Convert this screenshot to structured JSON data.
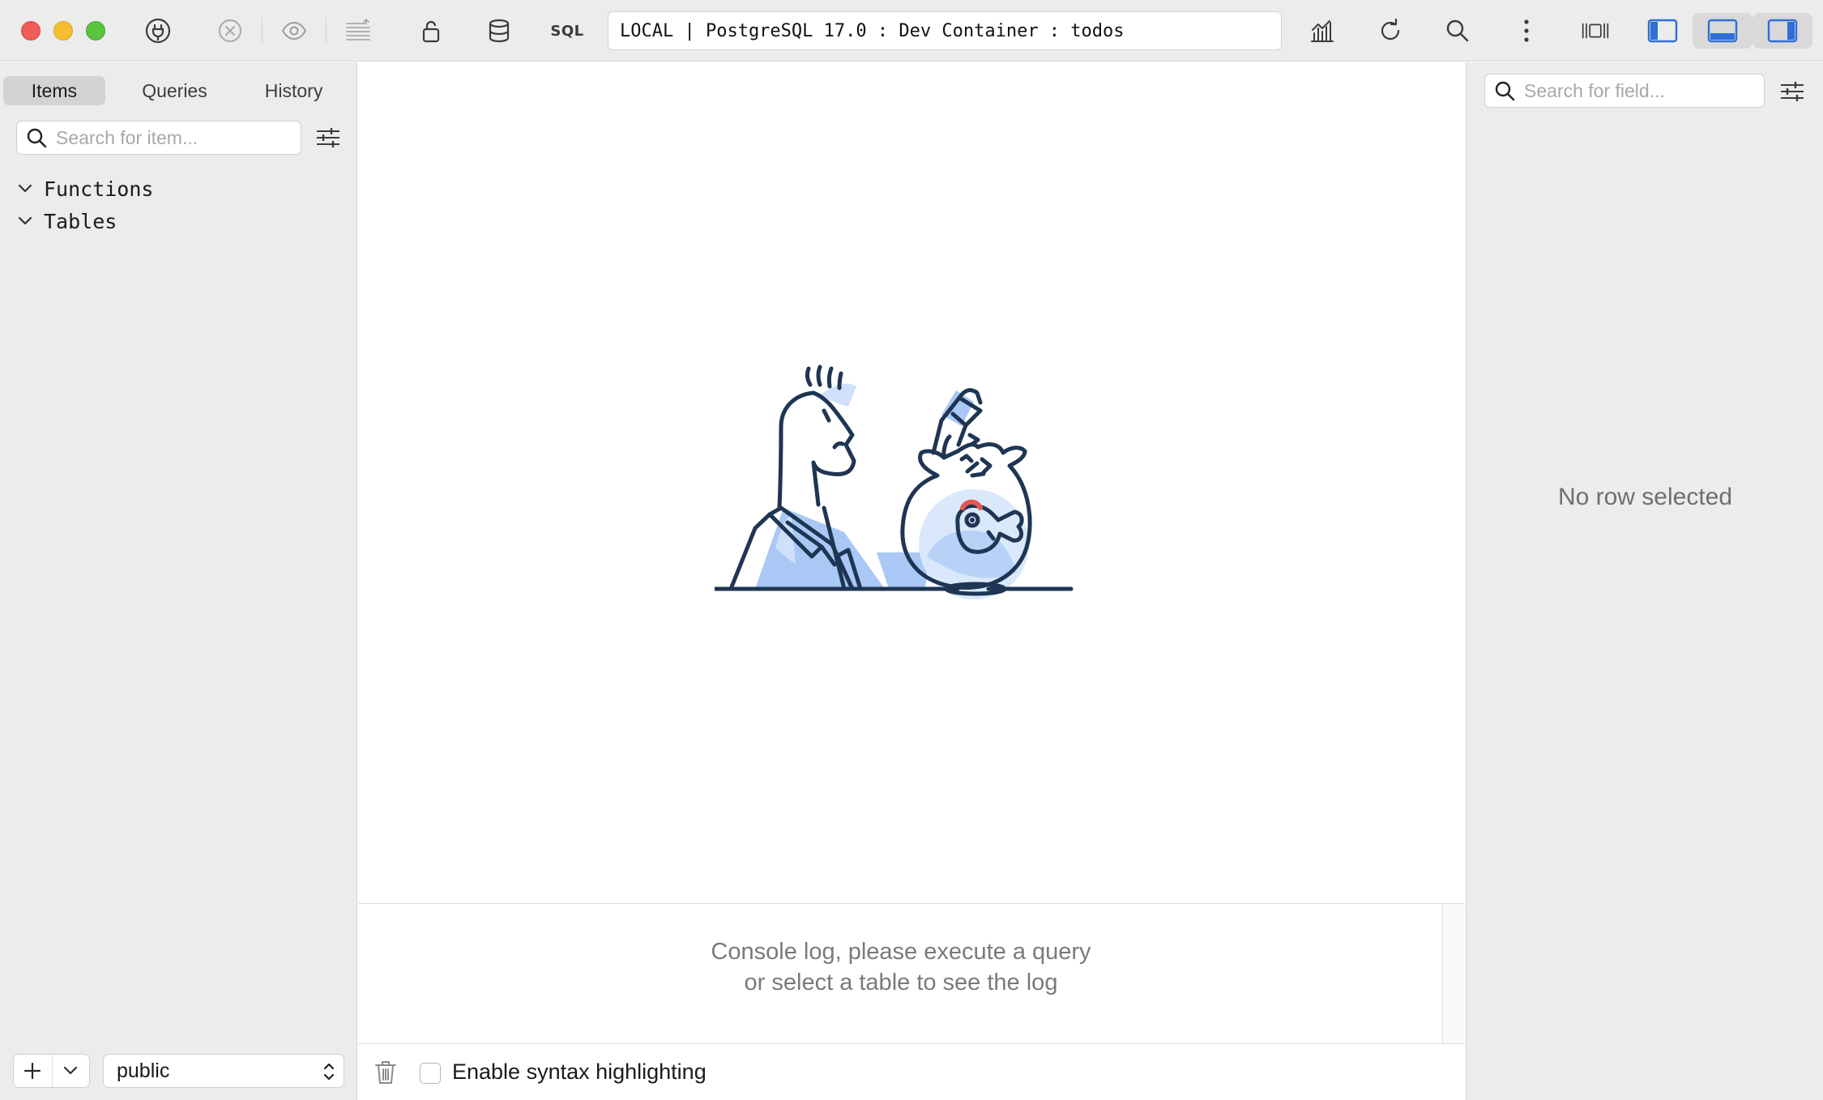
{
  "toolbar": {
    "sql_label": "SQL",
    "connection": "LOCAL | PostgreSQL 17.0 : Dev Container : todos"
  },
  "sidebar": {
    "tabs": [
      {
        "label": "Items",
        "active": true
      },
      {
        "label": "Queries",
        "active": false
      },
      {
        "label": "History",
        "active": false
      }
    ],
    "search_placeholder": "Search for item...",
    "tree": [
      {
        "label": "Functions",
        "expanded": true
      },
      {
        "label": "Tables",
        "expanded": true
      }
    ],
    "schema": "public"
  },
  "main": {
    "console_line1": "Console log, please execute a query",
    "console_line2": "or select a table to see the log",
    "syntax_label": "Enable syntax highlighting"
  },
  "right_panel": {
    "search_placeholder": "Search for field...",
    "empty_text": "No row selected"
  },
  "colors": {
    "accent": "#2f6fd6",
    "illustration_fill": "#a9c8f5",
    "illustration_stroke": "#1e3553"
  }
}
